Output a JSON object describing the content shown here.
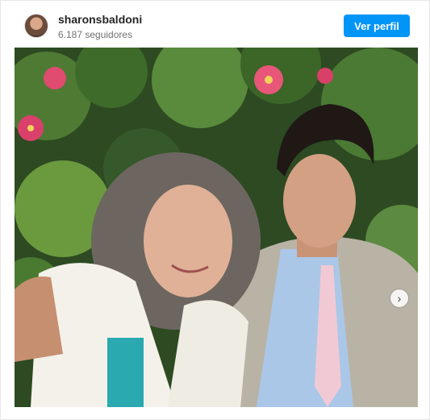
{
  "post": {
    "username": "sharonsbaldoni",
    "followers": "6.187 seguidores",
    "follow_button": "Ver perfil"
  },
  "icons": {
    "next": "chevron-right-icon",
    "avatar": "profile-avatar"
  }
}
